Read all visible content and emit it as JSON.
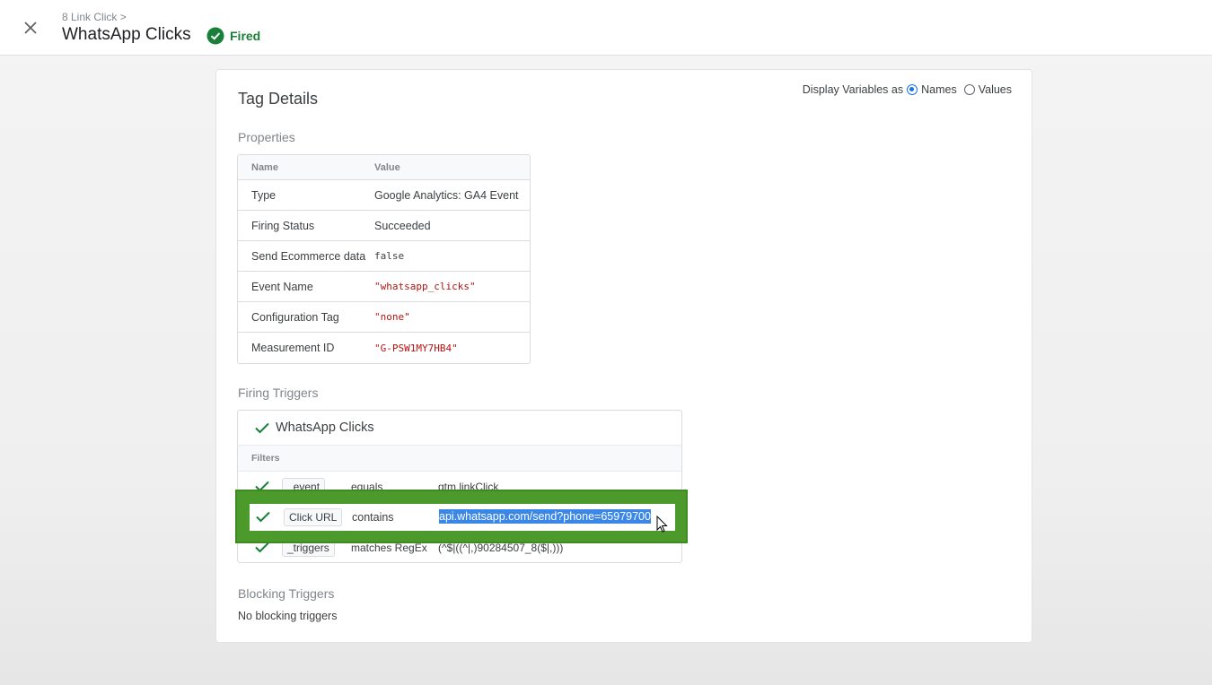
{
  "header": {
    "breadcrumb": "8 Link Click >",
    "title": "WhatsApp Clicks",
    "status": "Fired"
  },
  "card": {
    "title": "Tag Details",
    "display_vars": {
      "label": "Display Variables as",
      "option_names": "Names",
      "option_values": "Values",
      "selected": "Names"
    },
    "properties": {
      "label": "Properties",
      "col_name": "Name",
      "col_value": "Value",
      "rows": [
        {
          "name": "Type",
          "value": "Google Analytics: GA4 Event"
        },
        {
          "name": "Firing Status",
          "value": "Succeeded"
        },
        {
          "name": "Send Ecommerce data",
          "value": "false"
        },
        {
          "name": "Event Name",
          "value": "\"whatsapp_clicks\""
        },
        {
          "name": "Configuration Tag",
          "value": "\"none\""
        },
        {
          "name": "Measurement ID",
          "value": "\"G-PSW1MY7HB4\""
        }
      ]
    },
    "firing_triggers": {
      "label": "Firing Triggers",
      "trigger_name": "WhatsApp Clicks",
      "filters_label": "Filters",
      "filters": [
        {
          "variable": "_event",
          "operator": "equals",
          "value": "gtm.linkClick"
        },
        {
          "variable": "Click URL",
          "operator": "contains",
          "value": "api.whatsapp.com/send?phone=65979700"
        },
        {
          "variable": "_triggers",
          "operator": "matches RegEx",
          "value": "(^$|((^|,)90284507_8($|,)))"
        }
      ]
    },
    "blocking_triggers": {
      "label": "Blocking Triggers",
      "text": "No blocking triggers"
    }
  },
  "colors": {
    "success": "#188038",
    "highlight_box": "#4d9a2c",
    "selection": "#3a87e8",
    "string_value": "#b31412"
  }
}
